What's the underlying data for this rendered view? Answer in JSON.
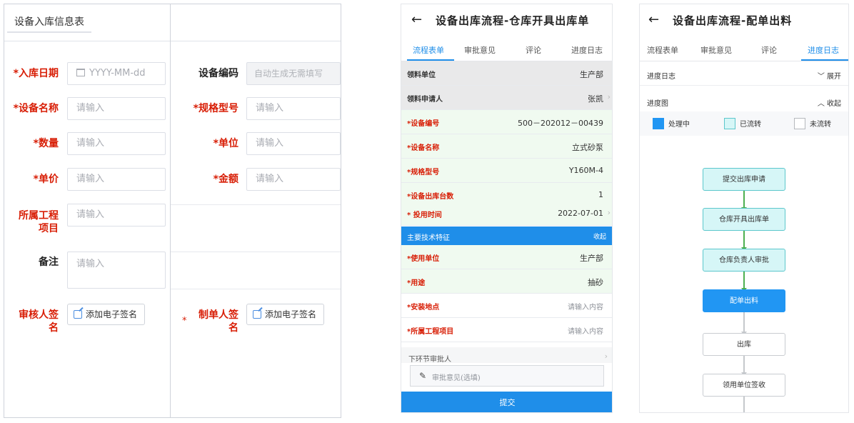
{
  "form": {
    "tab": "设备入库信息表",
    "fields": {
      "date_label": "*入库日期",
      "date_placeholder": "YYYY-MM-dd",
      "code_label": "设备编码",
      "code_placeholder": "自动生成无需填写",
      "name_label": "*设备名称",
      "name_placeholder": "请输入",
      "spec_label": "*规格型号",
      "spec_placeholder": "请输入",
      "qty_label": "*数量",
      "qty_placeholder": "请输入",
      "unit_label": "*单位",
      "unit_placeholder": "请输入",
      "price_label": "*单价",
      "price_placeholder": "请输入",
      "amount_label": "*金额",
      "amount_placeholder": "请输入",
      "project_label_line1": "所属工程",
      "project_label_line2": "项目",
      "project_placeholder": "请输入",
      "remark_label": "备注",
      "remark_placeholder": "请输入",
      "reviewer_label_line1": "审核人签",
      "reviewer_label_line2": "名",
      "maker_label_line1": "制单人签",
      "maker_label_line2": "名",
      "maker_star": "*",
      "sign_button": "添加电子签名"
    }
  },
  "outbound": {
    "title": "设备出库流程-仓库开具出库单",
    "tabs": [
      "流程表单",
      "审批意见",
      "评论",
      "进度日志"
    ],
    "rows": [
      {
        "label": "领料单位",
        "value": "生产部"
      },
      {
        "label": "领料申请人",
        "value": "张凯"
      },
      {
        "label": "*设备编号",
        "value": "500－202012－00439"
      },
      {
        "label": "*设备名称",
        "value": "立式砂泵"
      },
      {
        "label": "*规格型号",
        "value": "Y160M-4"
      },
      {
        "label": "*设备出库台数",
        "value": "1"
      },
      {
        "label": "* 投用时间",
        "value": "2022-07-01"
      }
    ],
    "section": {
      "label": "主要技术特征",
      "action": "收起"
    },
    "rows2": [
      {
        "label": "*使用单位",
        "value": "生产部"
      },
      {
        "label": "*用途",
        "value": "抽砂"
      },
      {
        "label": "*安装地点",
        "value": "请输入内容"
      },
      {
        "label": "*所属工程项目",
        "value": "请输入内容"
      }
    ],
    "next_approver": "下环节审批人",
    "opinion_placeholder": "审批意见(选填)",
    "submit": "提交"
  },
  "flow": {
    "title": "设备出库流程-配单出料",
    "tabs": [
      "流程表单",
      "审批意见",
      "评论",
      "进度日志"
    ],
    "log_label": "进度日志",
    "log_action": "展开",
    "chart_label": "进度图",
    "chart_action": "收起",
    "legend": [
      {
        "label": "处理中",
        "color": "#2196f3"
      },
      {
        "label": "已流转",
        "color": "#d6f6f7"
      },
      {
        "label": "未流转",
        "color": "#ffffff"
      }
    ],
    "nodes": [
      {
        "label": "提交出库申请",
        "status": "done"
      },
      {
        "label": "仓库开具出库单",
        "status": "done"
      },
      {
        "label": "仓库负责人审批",
        "status": "done"
      },
      {
        "label": "配单出料",
        "status": "current"
      },
      {
        "label": "出库",
        "status": "todo"
      },
      {
        "label": "领用单位签收",
        "status": "todo"
      }
    ]
  }
}
